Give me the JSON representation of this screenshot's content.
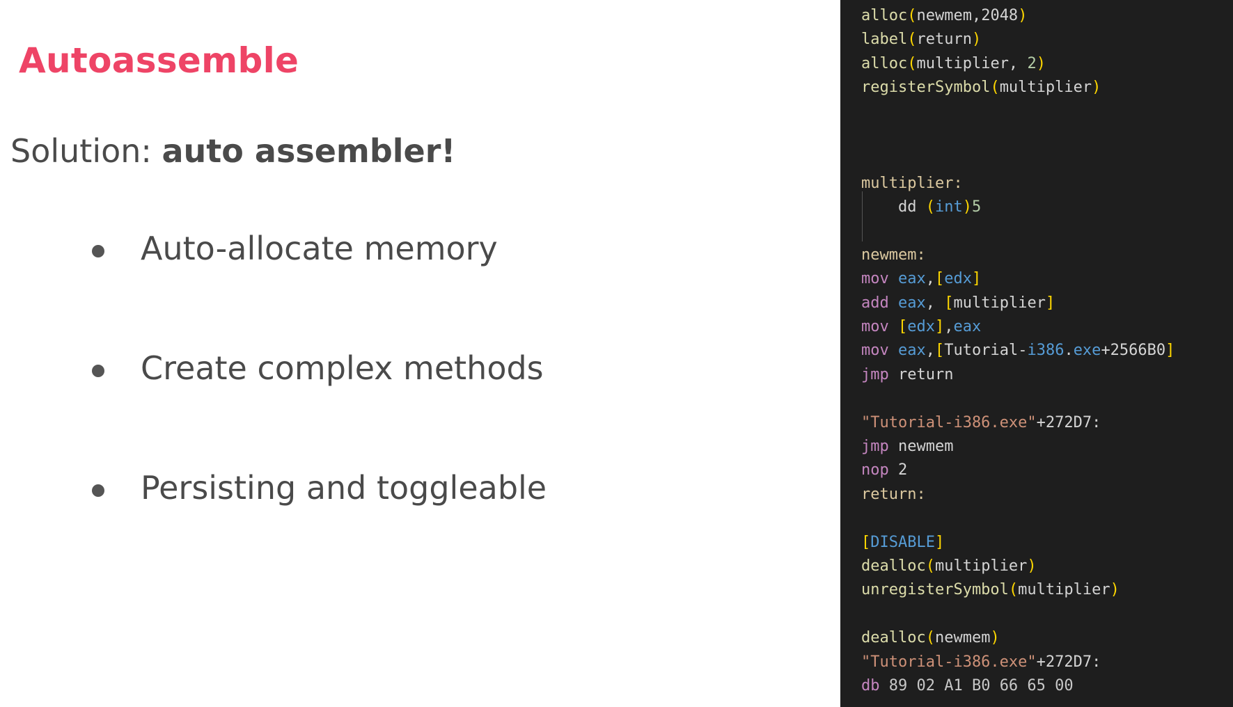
{
  "slide": {
    "title": "Autoassemble",
    "subtitle_prefix": "Solution: ",
    "subtitle_bold": "auto assembler!",
    "bullets": [
      "Auto-allocate memory",
      "Create complex methods",
      "Persisting and toggleable"
    ]
  },
  "code": {
    "lines": [
      [
        [
          "fn",
          "alloc"
        ],
        [
          "p1",
          "("
        ],
        [
          "plain",
          "newmem,2048"
        ],
        [
          "p1",
          ")"
        ]
      ],
      [
        [
          "fn",
          "label"
        ],
        [
          "p1",
          "("
        ],
        [
          "plain",
          "return"
        ],
        [
          "p1",
          ")"
        ]
      ],
      [
        [
          "fn",
          "alloc"
        ],
        [
          "p1",
          "("
        ],
        [
          "plain",
          "multiplier, "
        ],
        [
          "num",
          "2"
        ],
        [
          "p1",
          ")"
        ]
      ],
      [
        [
          "fn",
          "registerSymbol"
        ],
        [
          "p1",
          "("
        ],
        [
          "plain",
          "multiplier"
        ],
        [
          "p1",
          ")"
        ]
      ],
      [],
      [],
      [],
      [
        [
          "lbl",
          "multiplier:"
        ]
      ],
      [
        [
          "plain",
          "    dd "
        ],
        [
          "p1",
          "("
        ],
        [
          "reg",
          "int"
        ],
        [
          "p1",
          ")"
        ],
        [
          "num",
          "5"
        ]
      ],
      [],
      [
        [
          "lbl",
          "newmem:"
        ]
      ],
      [
        [
          "kw",
          "mov "
        ],
        [
          "reg",
          "eax"
        ],
        [
          "plain",
          ","
        ],
        [
          "p1",
          "["
        ],
        [
          "reg",
          "edx"
        ],
        [
          "p1",
          "]"
        ]
      ],
      [
        [
          "kw",
          "add "
        ],
        [
          "reg",
          "eax"
        ],
        [
          "plain",
          ", "
        ],
        [
          "p1",
          "["
        ],
        [
          "plain",
          "multiplier"
        ],
        [
          "p1",
          "]"
        ]
      ],
      [
        [
          "kw",
          "mov "
        ],
        [
          "p1",
          "["
        ],
        [
          "reg",
          "edx"
        ],
        [
          "p1",
          "]"
        ],
        [
          "plain",
          ","
        ],
        [
          "reg",
          "eax"
        ]
      ],
      [
        [
          "kw",
          "mov "
        ],
        [
          "reg",
          "eax"
        ],
        [
          "plain",
          ","
        ],
        [
          "p1",
          "["
        ],
        [
          "plain",
          "Tutorial-"
        ],
        [
          "reg",
          "i386"
        ],
        [
          "plain",
          "."
        ],
        [
          "reg",
          "exe"
        ],
        [
          "plain",
          "+2566B0"
        ],
        [
          "p1",
          "]"
        ]
      ],
      [
        [
          "kw",
          "jmp "
        ],
        [
          "plain",
          "return"
        ]
      ],
      [],
      [
        [
          "str",
          "\"Tutorial-i386.exe\""
        ],
        [
          "plain",
          "+272D7:"
        ]
      ],
      [
        [
          "kw",
          "jmp "
        ],
        [
          "plain",
          "newmem"
        ]
      ],
      [
        [
          "kw",
          "nop "
        ],
        [
          "plain",
          "2"
        ]
      ],
      [
        [
          "lbl",
          "return:"
        ]
      ],
      [],
      [
        [
          "p1",
          "["
        ],
        [
          "reg",
          "DISABLE"
        ],
        [
          "p1",
          "]"
        ]
      ],
      [
        [
          "fn",
          "dealloc"
        ],
        [
          "p1",
          "("
        ],
        [
          "plain",
          "multiplier"
        ],
        [
          "p1",
          ")"
        ]
      ],
      [
        [
          "fn",
          "unregisterSymbol"
        ],
        [
          "p1",
          "("
        ],
        [
          "plain",
          "multiplier"
        ],
        [
          "p1",
          ")"
        ]
      ],
      [],
      [
        [
          "fn",
          "dealloc"
        ],
        [
          "p1",
          "("
        ],
        [
          "plain",
          "newmem"
        ],
        [
          "p1",
          ")"
        ]
      ],
      [
        [
          "str",
          "\"Tutorial-i386.exe\""
        ],
        [
          "plain",
          "+272D7:"
        ]
      ],
      [
        [
          "kw",
          "db "
        ],
        [
          "opc",
          "89 02 A1 B0 66 65 00"
        ]
      ]
    ]
  }
}
